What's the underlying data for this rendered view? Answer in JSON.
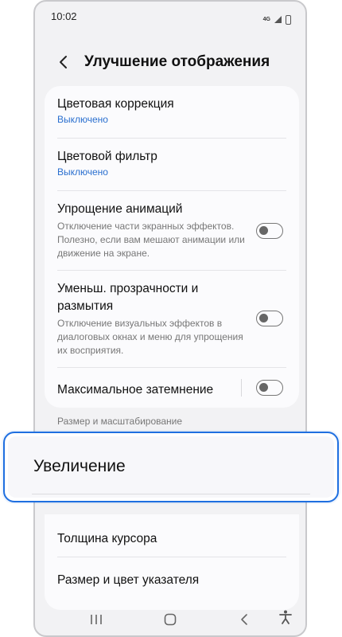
{
  "status": {
    "time": "10:02",
    "network": "4G"
  },
  "header": {
    "title": "Улучшение отображения"
  },
  "settings": [
    {
      "title": "Цветовая коррекция",
      "sub": "Выключено"
    },
    {
      "title": "Цветовой фильтр",
      "sub": "Выключено"
    },
    {
      "title": "Упрощение анимаций",
      "desc": "Отключение части экранных эффектов. Полезно, если вам мешают анимации или движение на экране.",
      "enabled": false
    },
    {
      "title": "Уменьш. прозрачности и размытия",
      "desc": "Отключение визуальных эффектов в диалоговых окнах и меню для упрощения их восприятия.",
      "enabled": false
    },
    {
      "title": "Максимальное затемнение",
      "enabled": false
    }
  ],
  "section": {
    "label": "Размер и масштабирование"
  },
  "magnified": {
    "label": "Увеличение"
  },
  "more": [
    {
      "title": "Толщина курсора"
    },
    {
      "title": "Размер и цвет указателя"
    }
  ],
  "icons": {
    "back": "chevron-left-icon",
    "recents": "recents-icon",
    "home": "home-icon",
    "nav_back": "nav-back-icon",
    "accessibility": "accessibility-icon"
  }
}
